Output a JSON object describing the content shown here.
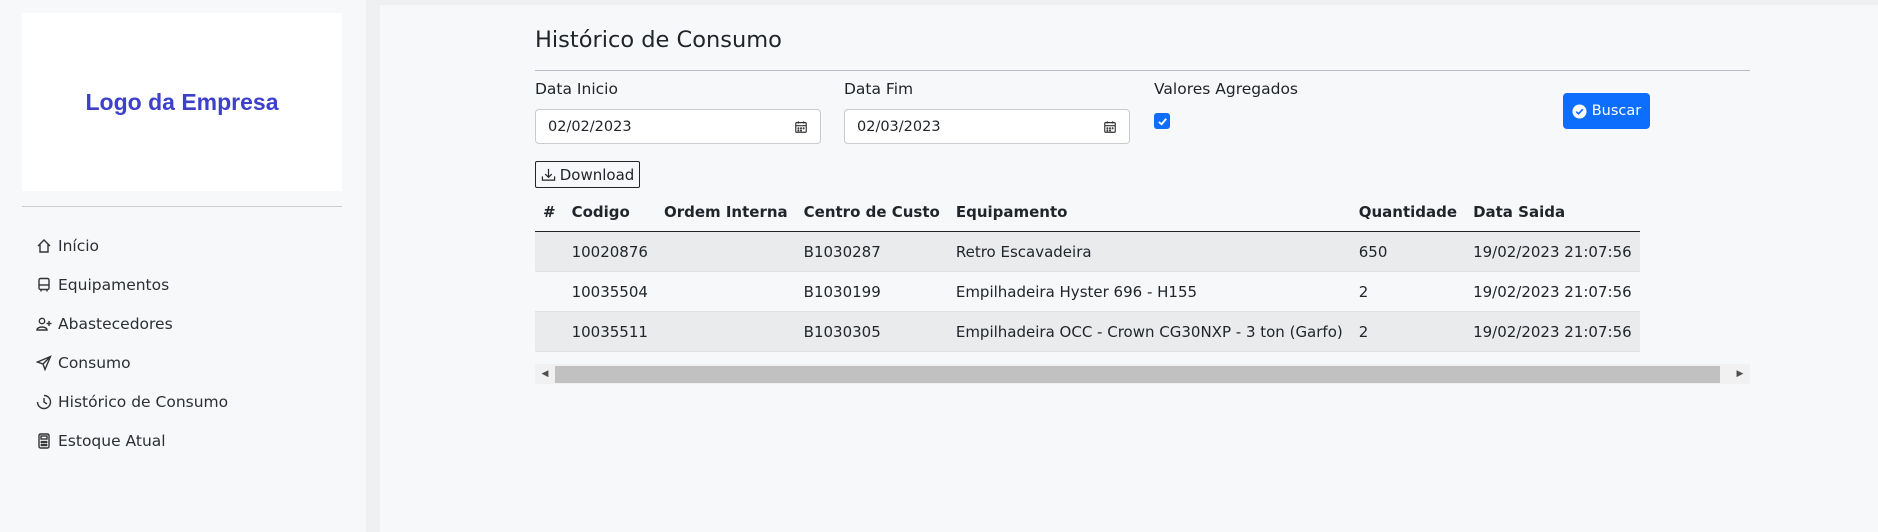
{
  "logo": {
    "text": "Logo da Empresa"
  },
  "nav": {
    "items": [
      {
        "label": "Início",
        "icon": "house-icon"
      },
      {
        "label": "Equipamentos",
        "icon": "bus-icon"
      },
      {
        "label": "Abastecedores",
        "icon": "person-plus-icon"
      },
      {
        "label": "Consumo",
        "icon": "send-icon"
      },
      {
        "label": "Histórico de Consumo",
        "icon": "clock-history-icon"
      },
      {
        "label": "Estoque Atual",
        "icon": "calculator-icon"
      }
    ]
  },
  "page": {
    "title": "Histórico de Consumo"
  },
  "filters": {
    "start_label": "Data Inicio",
    "start_value": "02/02/2023",
    "end_label": "Data Fim",
    "end_value": "02/03/2023",
    "aggregate_label": "Valores Agregados",
    "aggregate_checked": true,
    "search_label": "Buscar"
  },
  "download_label": "Download",
  "table": {
    "headers": [
      "#",
      "Codigo",
      "Ordem Interna",
      "Centro de Custo",
      "Equipamento",
      "Quantidade",
      "Data Saida"
    ],
    "rows": [
      [
        "",
        "10020876",
        "",
        "B1030287",
        "Retro Escavadeira",
        "650",
        "19/02/2023 21:07:56"
      ],
      [
        "",
        "10035504",
        "",
        "B1030199",
        "Empilhadeira Hyster 696 - H155",
        "2",
        "19/02/2023 21:07:56"
      ],
      [
        "",
        "10035511",
        "",
        "B1030305",
        "Empilhadeira OCC - Crown CG30NXP - 3 ton (Garfo)",
        "2",
        "19/02/2023 21:07:56"
      ]
    ]
  },
  "colors": {
    "primary": "#0d6efd",
    "logo": "#3d40c9"
  }
}
